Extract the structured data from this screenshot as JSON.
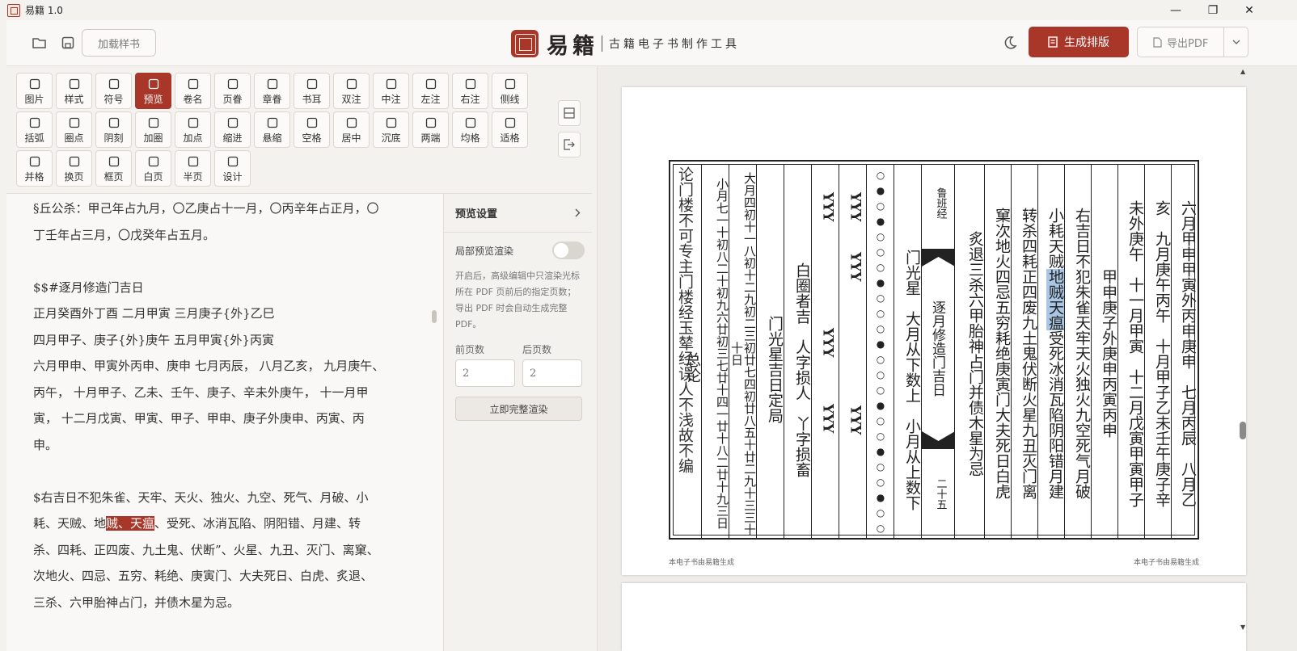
{
  "window": {
    "title": "易籍 1.0",
    "minimize": "—",
    "maximize": "❐",
    "close": "✕"
  },
  "header": {
    "load_sample": "加载样书",
    "brand_name": "易籍",
    "brand_sub": "古籍电子书制作工具",
    "generate": "生成排版",
    "export": "导出PDF"
  },
  "tools": [
    {
      "label": "图片"
    },
    {
      "label": "样式"
    },
    {
      "label": "符号"
    },
    {
      "label": "预览"
    },
    {
      "label": "卷名"
    },
    {
      "label": "页眷"
    },
    {
      "label": "章眷"
    },
    {
      "label": "书耳"
    },
    {
      "label": "双注"
    },
    {
      "label": "中注"
    },
    {
      "label": "左注"
    },
    {
      "label": "右注"
    },
    {
      "label": "侧线"
    },
    {
      "label": "括弧"
    },
    {
      "label": "圈点"
    },
    {
      "label": "阴刻"
    },
    {
      "label": "加圈"
    },
    {
      "label": "加点"
    },
    {
      "label": "缩进"
    },
    {
      "label": "悬缩"
    },
    {
      "label": "空格"
    },
    {
      "label": "居中"
    },
    {
      "label": "沉底"
    },
    {
      "label": "两端"
    },
    {
      "label": "均格"
    },
    {
      "label": "适格"
    },
    {
      "label": "并格"
    },
    {
      "label": "换页"
    },
    {
      "label": "框页"
    },
    {
      "label": "白页"
    },
    {
      "label": "半页"
    },
    {
      "label": "设计"
    }
  ],
  "editor": {
    "lines": [
      "§丘公杀：甲己年占九月，〇乙庚占十一月，〇丙辛年占正月，〇",
      "丁壬年占三月，〇戊癸年占五月。",
      "",
      "$$#逐月修造门吉日",
      "正月癸酉外丁酉 二月甲寅 三月庚子{外}乙巳",
      "四月甲子、庚子{外}庚午 五月甲寅{外}丙寅",
      "六月甲申、甲寅外丙申、庚申 七月丙辰， 八月乙亥， 九月庚午、",
      "丙午， 十月甲子、乙未、壬午、庚子、辛未外庚午， 十一月甲",
      "寅， 十二月戊寅、甲寅、甲子、甲申、庚子外庚申、丙寅、丙",
      "申。",
      ""
    ],
    "hl_before": "$右吉日不犯朱雀、天牢、天火、独火、九空、死气、月破、小",
    "hl_line_pre": "耗、天贼、地",
    "hl_text": "贼、天瘟",
    "hl_line_post": "、受死、冰消瓦陷、阴阳错、月建、转",
    "after_lines": [
      "杀、四耗、正四废、九土鬼、伏断”、火星、九丑、灭门、离窠、",
      "次地火、四忌、五穷、耗绝、庚寅门、大夫死日、白虎、炙退、",
      "三杀、六甲胎神占门，并债木星为忌。"
    ]
  },
  "settings": {
    "title": "预览设置",
    "partial_label": "局部预览渲染",
    "partial_on": false,
    "desc": "开启后，高级编辑中只渲染光标所在 PDF 页前后的指定页数；导出 PDF 时会自动生成完整 PDF。",
    "before_label": "前页数",
    "after_label": "后页数",
    "before_value": "2",
    "after_value": "2",
    "render_button": "立即完整渲染"
  },
  "preview": {
    "col1": "六月甲申甲寅外丙申庚申",
    "col1b": "七月丙辰",
    "col1c": "八月乙",
    "col2": "亥",
    "col2b": "九月庚午丙午",
    "col2c": "十月甲子乙未壬午庚子辛",
    "col3": "未外庚午",
    "col3b": "十一月甲寅",
    "col3c": "十二月戊寅甲寅甲子",
    "col4": "甲申庚子外庚申丙寅丙申",
    "col5": "右吉日不犯朱雀天牢天火独火九空死气月破",
    "col6_pre": "小耗天贼",
    "col6_hl": "地贼天瘟",
    "col6_post": "受死冰消瓦陷阴阳错月建",
    "col7": "转杀四耗正四废九土鬼伏断火星九丑灭门离",
    "col8": "窠次地火四忌五穷耗绝庚寅门大夫死日白虎",
    "col9": "炙退三杀六甲胎神占门并债木星为忌",
    "center_top": "鲁班经",
    "center_mid": "逐月修造门吉日",
    "center_bot": "二十五",
    "col10": "门光星",
    "col10b": "大月从下数上",
    "col10c": "小月从上数下",
    "dots": "○●○●○○○●○○○●○○○●○○●○○●○○",
    "glyph_a": "YYY",
    "glyph_b": "YYY",
    "glyph_c": "YYY",
    "glyph_d": "YYY",
    "glyph_e": "YYY",
    "glyph_f": "YYY",
    "col12": "白圈者吉",
    "col12b": "人字损人",
    "col12c": "丫字损畜",
    "col13": "门光星吉日定局",
    "grid_a": "大月四初十一八初十二九初二三初廿七四初廿八五十廿二九十三三十十日",
    "grid_b": "小月七一十初八二十初九六廿初三七廿十四一廿十八二廿十九三日",
    "col16": "总论",
    "col17": "论门楼不可专主门楼经玉辇经误人不浅故不编",
    "footer_left": "本电子书由易籍生成",
    "footer_right": "本电子书由易籍生成"
  }
}
